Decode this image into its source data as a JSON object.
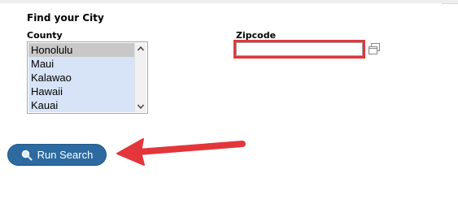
{
  "form": {
    "title": "Find your City",
    "county": {
      "label": "County",
      "options": [
        "Honolulu",
        "Maui",
        "Kalawao",
        "Hawaii",
        "Kauai"
      ],
      "selected": "Honolulu"
    },
    "zipcode": {
      "label": "Zipcode",
      "value": ""
    },
    "run_button_label": "Run Search"
  },
  "annotation": {
    "highlight_color": "#e3363b",
    "arrow_color": "#e3363b"
  },
  "icons": {
    "copy": "copy-icon",
    "search": "search-icon",
    "scroll_up": "chevron-up-icon",
    "scroll_down": "chevron-down-icon"
  }
}
